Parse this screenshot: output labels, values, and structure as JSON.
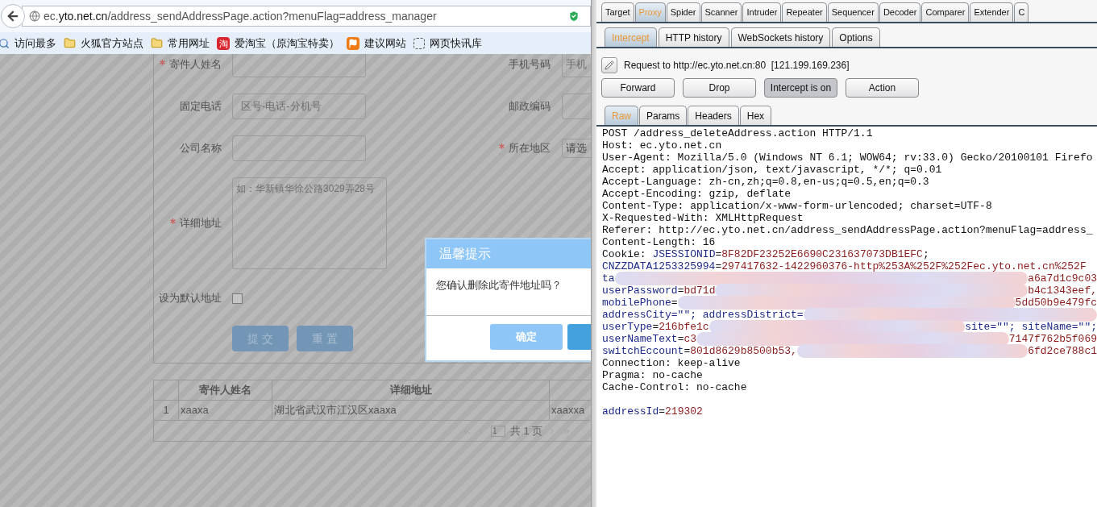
{
  "browser": {
    "url": "ec.**yto.net.cn**/address_sendAddressPage.action?menuFlag=address_manager",
    "bookmarks": [
      {
        "label": "访问最多",
        "kind": "search"
      },
      {
        "label": "火狐官方站点",
        "kind": "folder"
      },
      {
        "label": "常用网址",
        "kind": "folder"
      },
      {
        "label": "爱淘宝（原淘宝特卖）",
        "kind": "badge",
        "badge": "淘"
      },
      {
        "label": "建议网站",
        "kind": "flag"
      },
      {
        "label": "网页快讯库",
        "kind": "dashed"
      }
    ]
  },
  "form": {
    "rows": [
      {
        "kind": "text",
        "label": "寄件人姓名",
        "required": true,
        "right": {
          "label": "手机号码",
          "required": false,
          "placeholder": "手机"
        }
      },
      {
        "kind": "text",
        "label": "固定电话",
        "required": false,
        "placeholder": "区号-电话-分机号",
        "right": {
          "label": "邮政编码",
          "required": false
        }
      },
      {
        "kind": "text",
        "label": "公司名称",
        "required": false,
        "right": {
          "label": "所在地区",
          "required": true,
          "value": "请选"
        }
      },
      {
        "kind": "textarea",
        "label": "详细地址",
        "required": true,
        "placeholder": "如：华新镇华徐公路3029弄28号"
      },
      {
        "kind": "checkbox",
        "label": "设为默认地址",
        "checked": false
      }
    ],
    "buttons": [
      "提 交",
      "重 置"
    ]
  },
  "table": {
    "columns": [
      "寄件人姓名",
      "详细地址"
    ],
    "rows": [
      {
        "index": "1",
        "cells": [
          "xaaxa",
          "湖北省武汉市江汉区xaaxa",
          "xaaxxa"
        ]
      }
    ],
    "pager": {
      "page": "1",
      "total": "共 1 页"
    }
  },
  "dialog": {
    "title": "温馨提示",
    "message": "您确认删除此寄件地址吗？",
    "buttons": [
      "确定"
    ]
  },
  "burp": {
    "tabs": [
      {
        "label": "Target",
        "selected": false
      },
      {
        "label": "Proxy",
        "selected": true
      },
      {
        "label": "Spider",
        "selected": false
      },
      {
        "label": "Scanner",
        "selected": false
      },
      {
        "label": "Intruder",
        "selected": false
      },
      {
        "label": "Repeater",
        "selected": false
      },
      {
        "label": "Sequencer",
        "selected": false
      },
      {
        "label": "Decoder",
        "selected": false
      },
      {
        "label": "Comparer",
        "selected": false
      },
      {
        "label": "Extender",
        "selected": false
      },
      {
        "label": "C",
        "selected": false
      }
    ],
    "subtabs": [
      {
        "label": "Intercept",
        "selected": true
      },
      {
        "label": "HTTP history",
        "selected": false
      },
      {
        "label": "WebSockets history",
        "selected": false
      },
      {
        "label": "Options",
        "selected": false
      }
    ],
    "request_info": "Request to http://ec.yto.net.cn:80  [121.199.169.236]",
    "buttons": [
      {
        "label": "Forward",
        "pressed": false
      },
      {
        "label": "Drop",
        "pressed": false
      },
      {
        "label": "Intercept is on",
        "pressed": true
      },
      {
        "label": "Action",
        "pressed": false
      }
    ],
    "view_tabs": [
      {
        "label": "Raw",
        "selected": true
      },
      {
        "label": "Params",
        "selected": false
      },
      {
        "label": "Headers",
        "selected": false
      },
      {
        "label": "Hex",
        "selected": false
      }
    ],
    "raw_headers": [
      [
        {
          "kind": "plain",
          "text": "POST /address_deleteAddress.action HTTP/1.1"
        }
      ],
      [
        {
          "kind": "plain",
          "text": "Host: ec.yto.net.cn"
        }
      ],
      [
        {
          "kind": "plain",
          "text": "User-Agent: Mozilla/5.0 (Windows NT 6.1; WOW64; rv:33.0) Gecko/20100101 Firefo"
        }
      ],
      [
        {
          "kind": "plain",
          "text": "Accept: application/json, text/javascript, */*; q=0.01"
        }
      ],
      [
        {
          "kind": "plain",
          "text": "Accept-Language: zh-cn,zh;q=0.8,en-us;q=0.5,en;q=0.3"
        }
      ],
      [
        {
          "kind": "plain",
          "text": "Accept-Encoding: gzip, deflate"
        }
      ],
      [
        {
          "kind": "plain",
          "text": "Content-Type: application/x-www-form-urlencoded; charset=UTF-8"
        }
      ],
      [
        {
          "kind": "plain",
          "text": "X-Requested-With: XMLHttpRequest"
        }
      ],
      [
        {
          "kind": "plain",
          "text": "Referer: http://ec.yto.net.cn/address_sendAddressPage.action?menuFlag=address_"
        }
      ],
      [
        {
          "kind": "plain",
          "text": "Content-Length: 16"
        }
      ],
      [
        {
          "kind": "plain",
          "text": "Cookie: "
        },
        {
          "kind": "key",
          "text": "JSESSIONID"
        },
        {
          "kind": "plain",
          "text": "="
        },
        {
          "kind": "value",
          "text": "8F82DF23252E6690C231637073DB1EFC"
        },
        {
          "kind": "plain",
          "text": ";"
        }
      ],
      [
        {
          "kind": "key",
          "text": "CNZZDATA1253325994"
        },
        {
          "kind": "plain",
          "text": "="
        },
        {
          "kind": "value",
          "text": "297417632-1422960376-http%253A%252F%252Fec.yto.net.cn%252F"
        }
      ],
      [
        {
          "kind": "key",
          "text": "ta"
        },
        {
          "kind": "redacted"
        },
        {
          "kind": "value",
          "text": "a6a7d1c9c03"
        }
      ],
      [
        {
          "kind": "key",
          "text": "userPassword"
        },
        {
          "kind": "plain",
          "text": "="
        },
        {
          "kind": "value",
          "text": "bd71d"
        },
        {
          "kind": "redacted"
        },
        {
          "kind": "value",
          "text": "b4c1343eef,"
        }
      ],
      [
        {
          "kind": "key",
          "text": "mobilePhone"
        },
        {
          "kind": "plain",
          "text": "="
        },
        {
          "kind": "redacted"
        },
        {
          "kind": "value",
          "text": "5dd50b9e479fc"
        }
      ],
      [
        {
          "kind": "key",
          "text": "addressCity=\"\"; addressDistrict="
        },
        {
          "kind": "redacted"
        }
      ],
      [
        {
          "kind": "key",
          "text": "userType"
        },
        {
          "kind": "plain",
          "text": "="
        },
        {
          "kind": "value",
          "text": "216bfe1c"
        },
        {
          "kind": "redacted"
        },
        {
          "kind": "key",
          "text": "site=\"\"; siteName=\"\";"
        }
      ],
      [
        {
          "kind": "key",
          "text": "userNameText"
        },
        {
          "kind": "plain",
          "text": "="
        },
        {
          "kind": "value",
          "text": "c3"
        },
        {
          "kind": "redacted"
        },
        {
          "kind": "value",
          "text": "7147f762b5f069"
        }
      ],
      [
        {
          "kind": "key",
          "text": "switchEccount"
        },
        {
          "kind": "plain",
          "text": "="
        },
        {
          "kind": "value",
          "text": "801d8629b8500b53,"
        },
        {
          "kind": "redacted"
        },
        {
          "kind": "value",
          "text": "6fd2ce788c1"
        }
      ],
      [
        {
          "kind": "plain",
          "text": "Connection: keep-alive"
        }
      ],
      [
        {
          "kind": "plain",
          "text": "Pragma: no-cache"
        }
      ],
      [
        {
          "kind": "plain",
          "text": "Cache-Control: no-cache"
        }
      ]
    ],
    "raw_body": [
      [
        {
          "kind": "key",
          "text": "addressId"
        },
        {
          "kind": "plain",
          "text": "="
        },
        {
          "kind": "value",
          "text": "219302"
        }
      ]
    ]
  }
}
